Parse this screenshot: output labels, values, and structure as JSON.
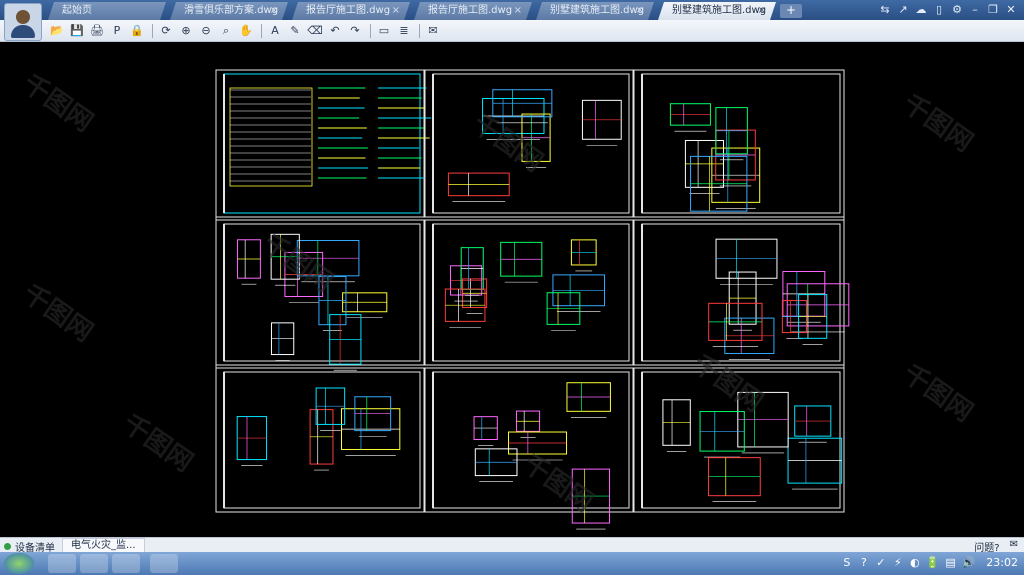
{
  "tabs": [
    {
      "label": "起始页",
      "active": false
    },
    {
      "label": "滑雪俱乐部方案.dwg",
      "active": false
    },
    {
      "label": "报告厅施工图.dwg",
      "active": false
    },
    {
      "label": "报告厅施工图.dwg",
      "active": false
    },
    {
      "label": "别墅建筑施工图.dwg",
      "active": false
    },
    {
      "label": "别墅建筑施工图.dwg",
      "active": true
    }
  ],
  "tab_close": "×",
  "new_tab": "+",
  "system_icons": [
    "sync-icon",
    "share-icon",
    "cloud-icon",
    "phone-icon",
    "settings-icon",
    "minimize-icon",
    "restore-icon",
    "close-icon"
  ],
  "system_glyphs": [
    "⇆",
    "↗",
    "☁",
    "▯",
    "⚙",
    "–",
    "❐",
    "✕"
  ],
  "toolbar": {
    "buttons": [
      "open",
      "save",
      "print",
      "pdf",
      "lock",
      "rotate",
      "zoom-in",
      "zoom-out",
      "zoom-window",
      "pan",
      "text",
      "pen",
      "eraser",
      "undo",
      "redo",
      "measure",
      "layers",
      "notes"
    ],
    "glyphs": [
      "📂",
      "💾",
      "🖨",
      "P",
      "🔒",
      "⟳",
      "⊕",
      "⊖",
      "⌕",
      "✋",
      "A",
      "✎",
      "⌫",
      "↶",
      "↷",
      "▭",
      "≣",
      "✉"
    ]
  },
  "status": {
    "left": "设备清单",
    "task": "电气火灾_监...",
    "help": "问题?",
    "right_icon": "chat-icon"
  },
  "taskbar": {
    "clock": "23:02",
    "tray_glyphs": [
      "S",
      "?",
      "✓",
      "⚡",
      "◐",
      "🔋",
      "▤",
      "🔊"
    ]
  },
  "watermark": "千图网"
}
